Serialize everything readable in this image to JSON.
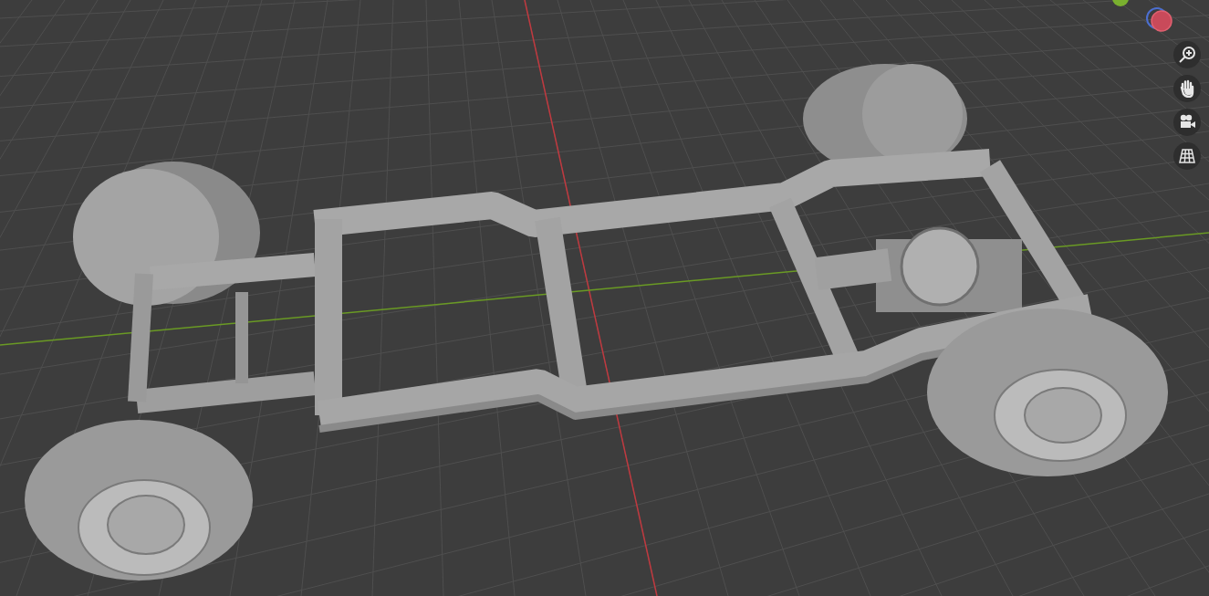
{
  "viewport_tools": [
    {
      "kind": "zoom"
    },
    {
      "kind": "pan"
    },
    {
      "kind": "camera"
    },
    {
      "kind": "grid"
    }
  ]
}
